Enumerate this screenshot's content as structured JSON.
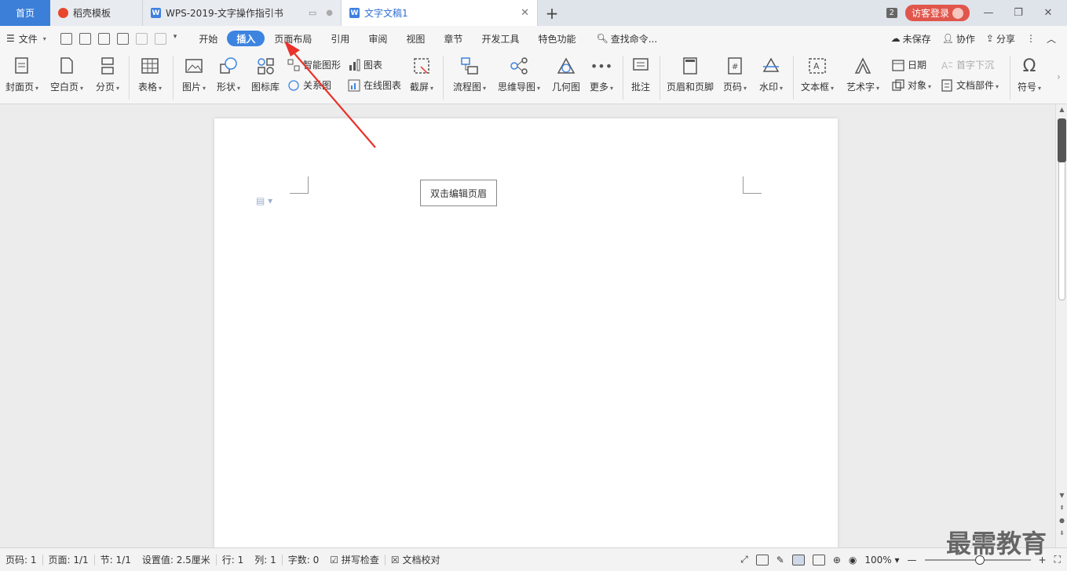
{
  "tabbar": {
    "home": "首页",
    "tabs": [
      {
        "label": "稻壳模板"
      },
      {
        "label": "WPS-2019-文字操作指引书"
      },
      {
        "label": "文字文稿1"
      }
    ],
    "window_count": "2",
    "login": "访客登录"
  },
  "menu": {
    "file": "文件",
    "tabs": [
      "开始",
      "插入",
      "页面布局",
      "引用",
      "审阅",
      "视图",
      "章节",
      "开发工具",
      "特色功能"
    ],
    "active_tab": "插入",
    "search": "查找命令...",
    "unsaved": "未保存",
    "collab": "协作",
    "share": "分享"
  },
  "ribbon": {
    "cover": "封面页",
    "blank": "空白页",
    "pagebreak": "分页",
    "table": "表格",
    "picture": "图片",
    "shape": "形状",
    "iconlib": "图标库",
    "smartart": "智能图形",
    "relation": "关系图",
    "chart": "图表",
    "onlinechart": "在线图表",
    "screenshot": "截屏",
    "flowchart": "流程图",
    "mindmap": "思维导图",
    "geometry": "几何图",
    "more": "更多",
    "comment": "批注",
    "headerfooter": "页眉和页脚",
    "pagenum": "页码",
    "watermark": "水印",
    "textbox": "文本框",
    "wordart": "艺术字",
    "date": "日期",
    "dropcap": "首字下沉",
    "object": "对象",
    "docparts": "文档部件",
    "symbol": "符号"
  },
  "document": {
    "header_hint": "双击编辑页眉"
  },
  "status": {
    "pagenum": "页码: 1",
    "pages": "页面: 1/1",
    "section": "节: 1/1",
    "setting": "设置值: 2.5厘米",
    "row": "行: 1",
    "col": "列: 1",
    "words": "字数: 0",
    "spell": "拼写检查",
    "proof": "文档校对",
    "zoom": "100%"
  },
  "watermark_text": "最需教育",
  "colors": {
    "accent": "#3c84e0",
    "login": "#e0564b",
    "arrow": "#e8322a"
  }
}
